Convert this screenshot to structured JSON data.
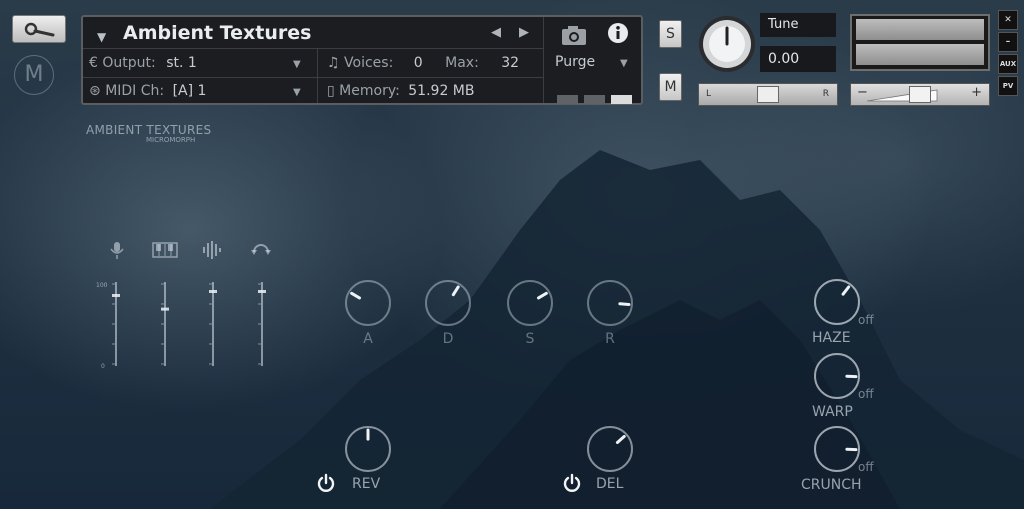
{
  "header": {
    "instrument_name": "Ambient Textures",
    "output_label": "Output:",
    "output_value": "st. 1",
    "voices_label": "Voices:",
    "voices_value": "0",
    "max_label": "Max:",
    "max_value": "32",
    "midi_label": "MIDI Ch:",
    "midi_value": "[A]  1",
    "memory_label": "Memory:",
    "memory_value": "51.92 MB",
    "purge_label": "Purge",
    "solo_label": "S",
    "mute_label": "M",
    "tune_label": "Tune",
    "tune_value": "0.00",
    "pan_left": "L",
    "pan_right": "R",
    "vol_minus": "−",
    "vol_plus": "+",
    "aux_label": "AUX",
    "pv_label": "PV",
    "close_label": "✕",
    "minimize_label": "–"
  },
  "brand": {
    "title": "AMBIENT TEXTURES",
    "subtitle": "MICROMORPH"
  },
  "mixer": {
    "scale_top": "100",
    "scale_bottom": "0",
    "channels": [
      {
        "icon": "microphone-icon",
        "level": 0.85
      },
      {
        "icon": "keyboard-icon",
        "level": 0.68
      },
      {
        "icon": "waveform-icon",
        "level": 0.9
      },
      {
        "icon": "loop-icon",
        "level": 0.9
      }
    ]
  },
  "envelope": [
    {
      "label": "A",
      "value": 0.28
    },
    {
      "label": "D",
      "value": 0.62
    },
    {
      "label": "S",
      "value": 0.72
    },
    {
      "label": "R",
      "value": 0.85
    }
  ],
  "fx": [
    {
      "label": "REV",
      "value": 0.5
    },
    {
      "label": "DEL",
      "value": 0.68
    }
  ],
  "macros": [
    {
      "label": "HAZE",
      "state": "off",
      "value": 0.64
    },
    {
      "label": "WARP",
      "state": "off",
      "value": 0.84
    },
    {
      "label": "CRUNCH",
      "state": "off",
      "value": 0.84
    }
  ]
}
